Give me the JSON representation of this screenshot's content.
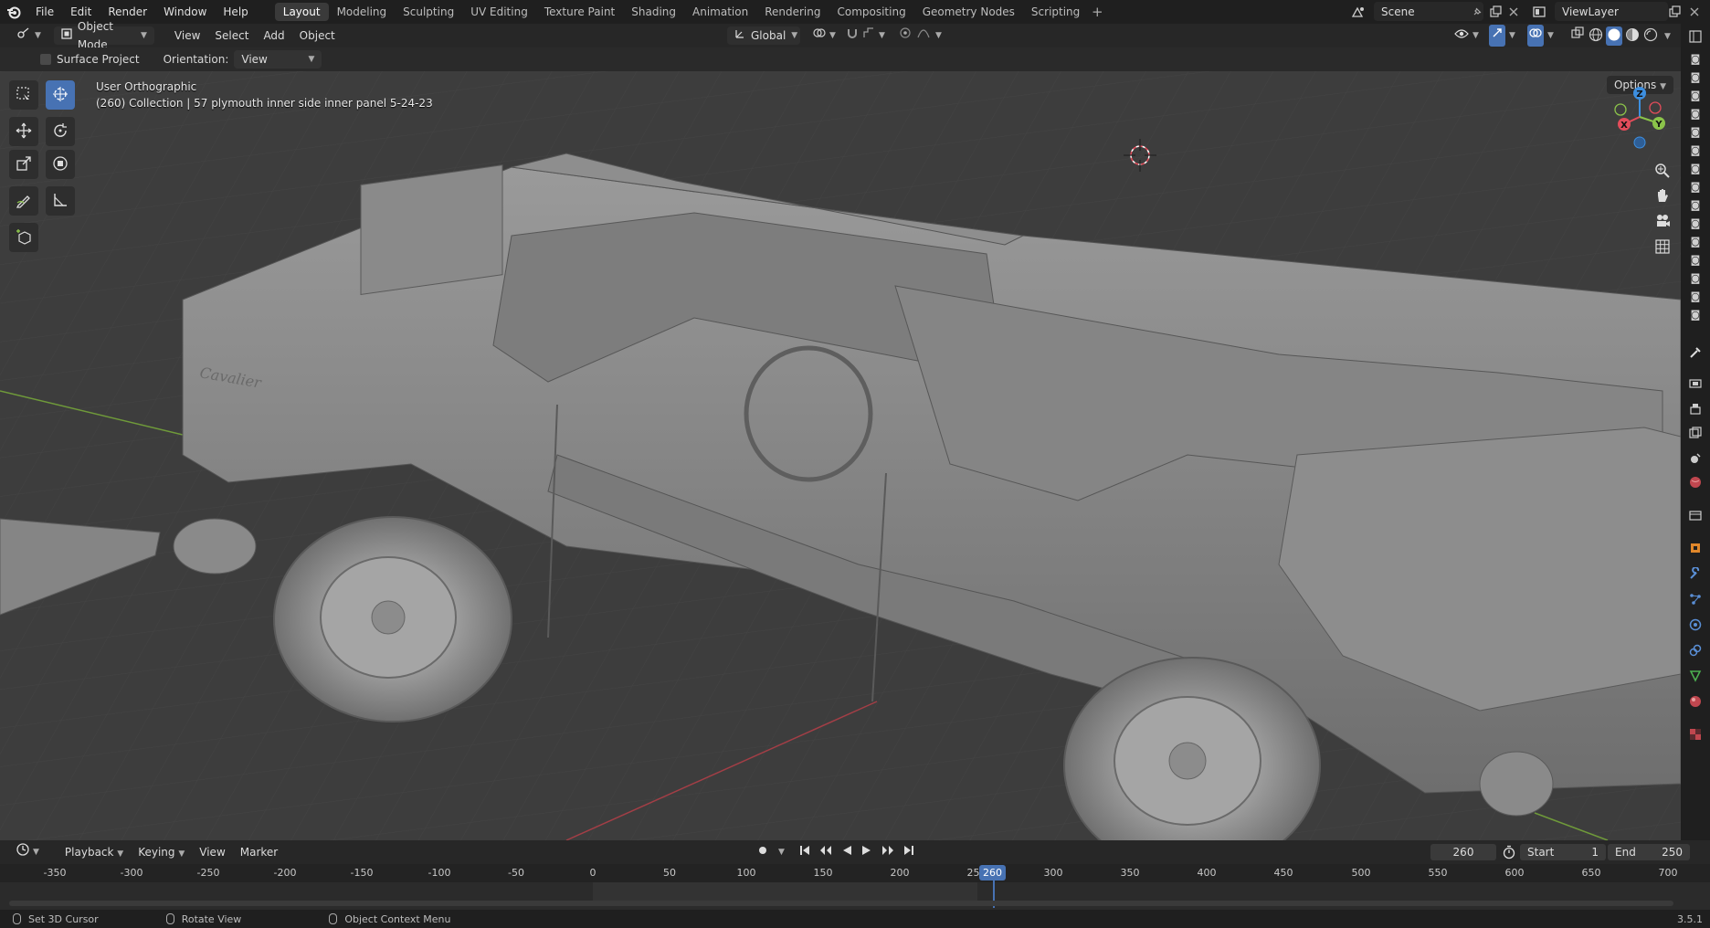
{
  "menu": [
    "File",
    "Edit",
    "Render",
    "Window",
    "Help"
  ],
  "workspaces": [
    "Layout",
    "Modeling",
    "Sculpting",
    "UV Editing",
    "Texture Paint",
    "Shading",
    "Animation",
    "Rendering",
    "Compositing",
    "Geometry Nodes",
    "Scripting"
  ],
  "active_workspace": "Layout",
  "add_workspace": "+",
  "scene": "Scene",
  "view_layer": "ViewLayer",
  "header": {
    "mode": "Object Mode",
    "menus": [
      "View",
      "Select",
      "Add",
      "Object"
    ],
    "transform_orientation": "Global"
  },
  "tool_settings": {
    "surface_project": "Surface Project",
    "orientation_label": "Orientation:",
    "orientation_value": "View"
  },
  "viewport": {
    "view_name": "User Orthographic",
    "object_info": "(260) Collection | 57 plymouth  inner side inner panel 5-24-23",
    "options": "Options",
    "axes": {
      "x": "X",
      "y": "Y",
      "z": "Z"
    }
  },
  "timeline": {
    "menus": [
      "Playback",
      "Keying",
      "View",
      "Marker"
    ],
    "current_frame": "260",
    "start_label": "Start",
    "start_value": "1",
    "end_label": "End",
    "end_value": "250",
    "ticks": [
      "-350",
      "-300",
      "-250",
      "-200",
      "-150",
      "-100",
      "-50",
      "0",
      "50",
      "100",
      "150",
      "200",
      "250",
      "300",
      "350",
      "400",
      "450",
      "500",
      "550",
      "600",
      "650",
      "700"
    ],
    "playhead_label": "260"
  },
  "status": {
    "left_click": "Set 3D Cursor",
    "middle_click": "Rotate View",
    "right_click": "Object Context Menu",
    "version": "3.5.1"
  },
  "colors": {
    "accent": "#4772b3",
    "x_axis": "#e34c5a",
    "y_axis": "#8bc34a",
    "z_axis": "#3d8fe0",
    "viewport_bg": "#3d3d3d"
  }
}
